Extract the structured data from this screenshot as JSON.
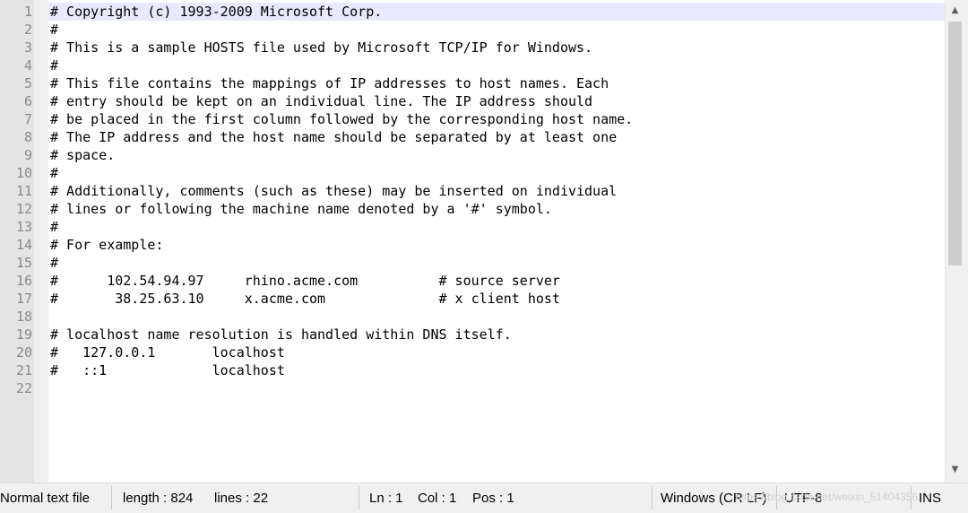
{
  "editor": {
    "line_numbers": [
      "1",
      "2",
      "3",
      "4",
      "5",
      "6",
      "7",
      "8",
      "9",
      "10",
      "11",
      "12",
      "13",
      "14",
      "15",
      "16",
      "17",
      "18",
      "19",
      "20",
      "21",
      "22"
    ],
    "lines": [
      "# Copyright (c) 1993-2009 Microsoft Corp.",
      "#",
      "# This is a sample HOSTS file used by Microsoft TCP/IP for Windows.",
      "#",
      "# This file contains the mappings of IP addresses to host names. Each",
      "# entry should be kept on an individual line. The IP address should",
      "# be placed in the first column followed by the corresponding host name.",
      "# The IP address and the host name should be separated by at least one",
      "# space.",
      "#",
      "# Additionally, comments (such as these) may be inserted on individual",
      "# lines or following the machine name denoted by a '#' symbol.",
      "#",
      "# For example:",
      "#",
      "#      102.54.94.97     rhino.acme.com          # source server",
      "#       38.25.63.10     x.acme.com              # x client host",
      "",
      "# localhost name resolution is handled within DNS itself.",
      "#   127.0.0.1       localhost",
      "#   ::1             localhost",
      ""
    ],
    "current_line": 1
  },
  "scrollbar": {
    "up_arrow_icon": "chevron-up-icon",
    "down_arrow_icon": "chevron-down-icon"
  },
  "statusbar": {
    "file_type": "Normal text file",
    "length": "length : 824",
    "lines": "lines : 22",
    "ln": "Ln : 1",
    "col": "Col : 1",
    "pos": "Pos : 1",
    "eol": "Windows (CR LF)",
    "encoding": "UTF-8",
    "watermark": "https://blog.csdn.net/weixin_51404356",
    "mode": "INS"
  },
  "colors": {
    "gutter_bg": "#e4e4e4",
    "current_line_bg": "#e8e8ff",
    "line_number_color": "#8a8a8a",
    "statusbar_bg": "#f0f0f0"
  }
}
